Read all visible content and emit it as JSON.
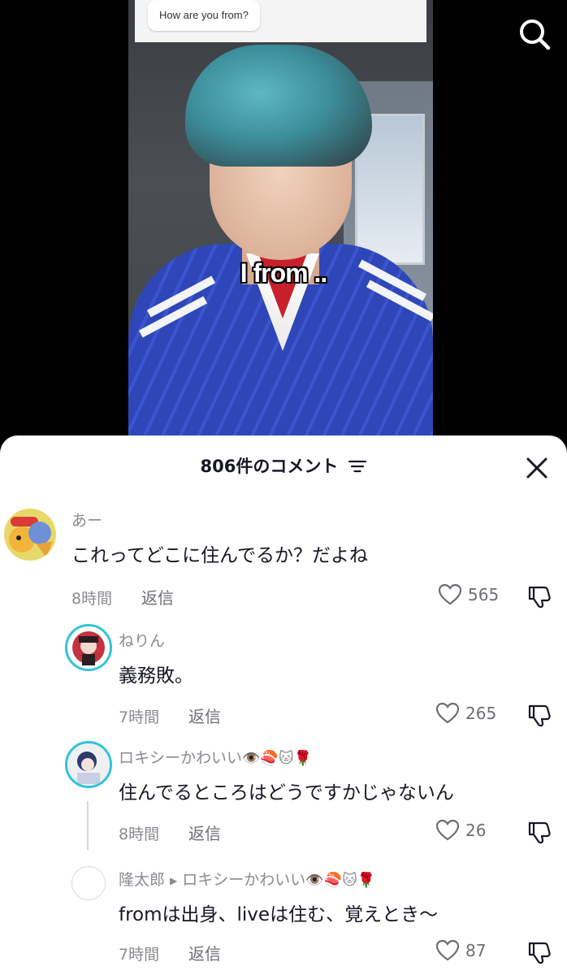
{
  "video": {
    "question": "How are you from?",
    "caption": "I from .."
  },
  "comments_panel": {
    "count_label": "806件のコメント"
  },
  "comments": [
    {
      "username": "あー",
      "text": "これってどこに住んでるか？だよね",
      "time": "8時間",
      "reply_label": "返信",
      "likes": "565"
    },
    {
      "username": "ねりん",
      "text": "義務敗。",
      "time": "7時間",
      "reply_label": "返信",
      "likes": "265"
    },
    {
      "username": "ロキシーかわいい",
      "username_emoji": "👁️🍣🐱🌹",
      "text": "住んでるところはどうですかじゃないん",
      "time": "8時間",
      "reply_label": "返信",
      "likes": "26"
    },
    {
      "username": "隆太郎",
      "reply_to": "ロキシーかわいい",
      "reply_to_emoji": "👁️🍣🐱🌹",
      "text": "fromは出身、liveは住む、覚えとき〜",
      "time": "7時間",
      "reply_label": "返信",
      "likes": "87"
    }
  ],
  "colors": {
    "text_primary": "#161823",
    "text_secondary": "#8a8b91",
    "shirt_blue": "#2f46b8",
    "hair_teal": "#5fb7c4"
  },
  "icons": [
    "search-icon",
    "filter-icon",
    "close-icon",
    "heart-icon",
    "dislike-icon",
    "play-arrow-icon"
  ]
}
